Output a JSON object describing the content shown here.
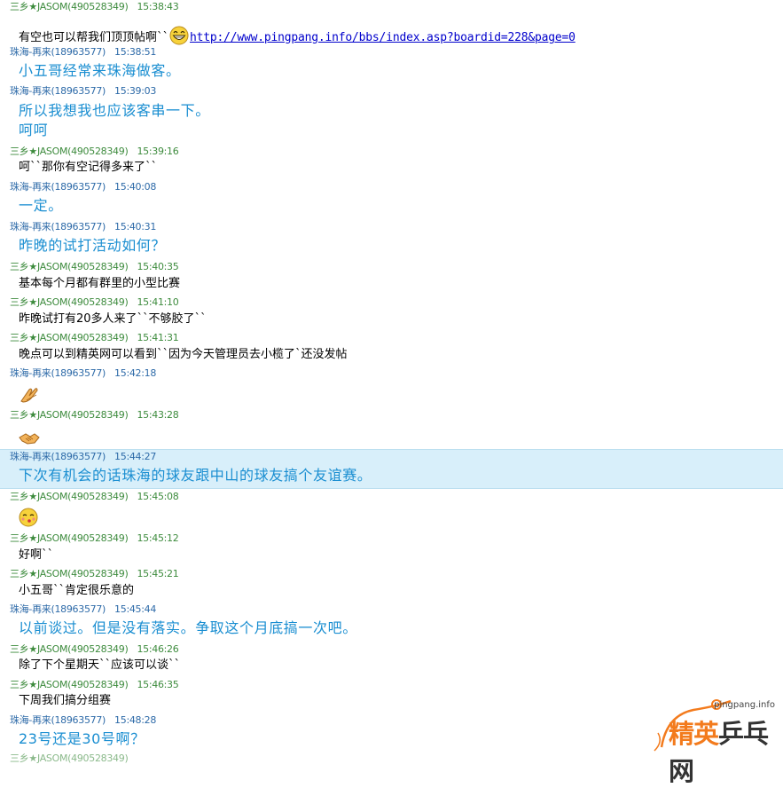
{
  "chat": {
    "messages": [
      {
        "sender": "三乡★JASOM(490528349)",
        "time": "15:38:43",
        "text": "有空也可以帮我们顶顶帖啊``",
        "url": "http://www.pingpang.info/bbs/index.asp?boardid=228&page=0",
        "icon": "grin-emoticon"
      },
      {
        "sender": "珠海-再来(18963577)",
        "time": "15:38:51",
        "text": "小五哥经常来珠海做客。"
      },
      {
        "sender": "珠海-再来(18963577)",
        "time": "15:39:03",
        "text": "所以我想我也应该客串一下。",
        "text2": "呵呵"
      },
      {
        "sender": "三乡★JASOM(490528349)",
        "time": "15:39:16",
        "text": "呵``那你有空记得多来了``"
      },
      {
        "sender": "珠海-再来(18963577)",
        "time": "15:40:08",
        "text": "一定。"
      },
      {
        "sender": "珠海-再来(18963577)",
        "time": "15:40:31",
        "text": "昨晚的试打活动如何？"
      },
      {
        "sender": "三乡★JASOM(490528349)",
        "time": "15:40:35",
        "text": "基本每个月都有群里的小型比赛"
      },
      {
        "sender": "三乡★JASOM(490528349)",
        "time": "15:41:10",
        "text": "昨晚试打有20多人来了``不够胶了``"
      },
      {
        "sender": "三乡★JASOM(490528349)",
        "time": "15:41:31",
        "text": "晚点可以到精英网可以看到``因为今天管理员去小榄了`还没发帖"
      },
      {
        "sender": "珠海-再来(18963577)",
        "time": "15:42:18",
        "icon": "clap-hands-emoticon"
      },
      {
        "sender": "三乡★JASOM(490528349)",
        "time": "15:43:28",
        "icon": "handshake-emoticon"
      },
      {
        "sender": "珠海-再来(18963577)",
        "time": "15:44:27",
        "text": "下次有机会的话珠海的球友跟中山的球友搞个友谊赛。"
      },
      {
        "sender": "三乡★JASOM(490528349)",
        "time": "15:45:08",
        "icon": "kiss-face-emoticon"
      },
      {
        "sender": "三乡★JASOM(490528349)",
        "time": "15:45:12",
        "text": "好啊``"
      },
      {
        "sender": "三乡★JASOM(490528349)",
        "time": "15:45:21",
        "text": "小五哥``肯定很乐意的"
      },
      {
        "sender": "珠海-再来(18963577)",
        "time": "15:45:44",
        "text": "以前谈过。但是没有落实。争取这个月底搞一次吧。"
      },
      {
        "sender": "三乡★JASOM(490528349)",
        "time": "15:46:26",
        "text": "除了下个星期天``应该可以谈``"
      },
      {
        "sender": "三乡★JASOM(490528349)",
        "time": "15:46:35",
        "text": "下周我们搞分组赛"
      },
      {
        "sender": "珠海-再来(18963577)",
        "time": "15:48:28",
        "text": "23号还是30号啊？"
      }
    ]
  },
  "watermark": {
    "site": "pingpang.info",
    "name_orange": "精英",
    "name_dark": "乒乓网"
  },
  "colors": {
    "sender_jasom": "#3d8b3d",
    "sender_zhuhai": "#2d6aa8",
    "zhuhai_text": "#1a8ed1",
    "highlight_row": "#d8effa"
  }
}
